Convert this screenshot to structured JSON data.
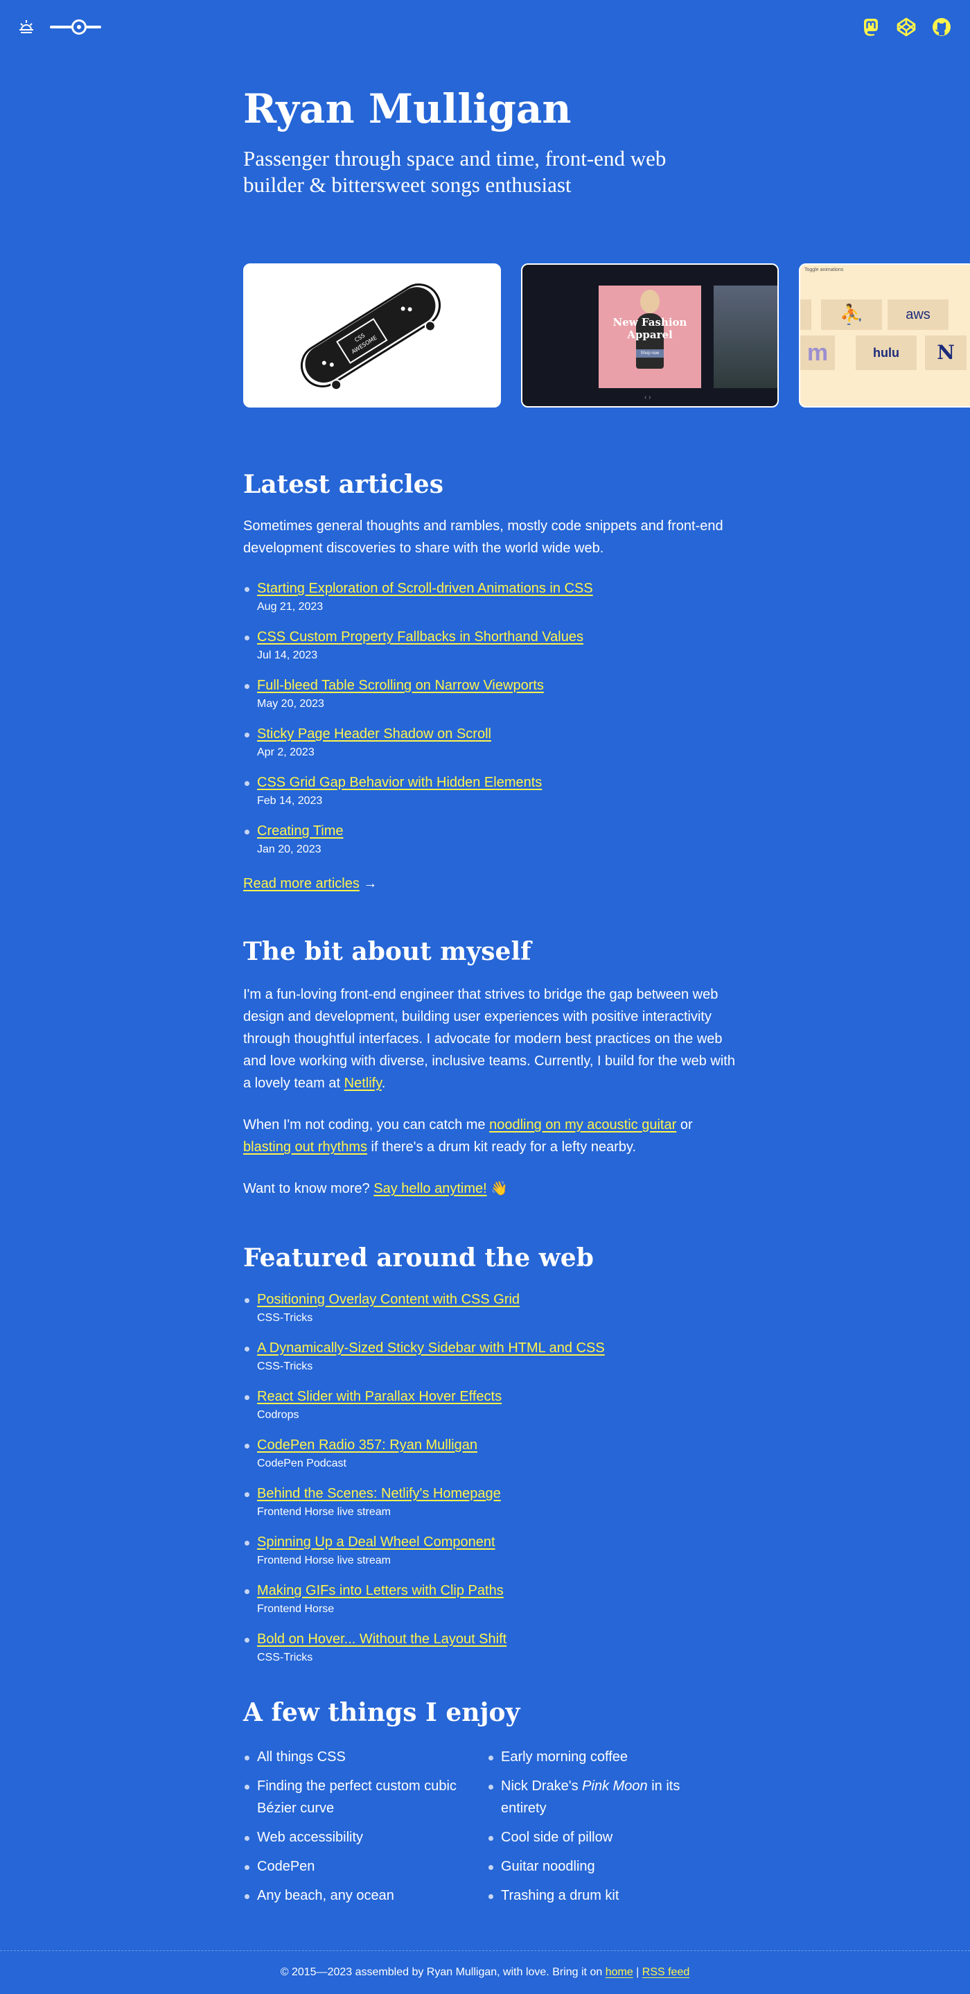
{
  "header": {
    "icons": [
      "sun-icon",
      "mastodon-icon",
      "codepen-icon",
      "github-icon"
    ],
    "slider_level": 0.6
  },
  "hero": {
    "name": "Ryan Mulligan",
    "tagline": "Passenger through space and time, front-end web builder & bittersweet songs enthusiast"
  },
  "cards": {
    "skateboard_text": "CSS\nAWESOME",
    "fashion_title": "New Fashion Apparel",
    "fashion_button": "Shop now",
    "logos_header": "Toggle animations",
    "logos": [
      "aws",
      "hulu",
      "N"
    ]
  },
  "articles": {
    "heading": "Latest articles",
    "intro": "Sometimes general thoughts and rambles, mostly code snippets and front-end development discoveries to share with the world wide web.",
    "items": [
      {
        "title": "Starting Exploration of Scroll-driven Animations in CSS",
        "date": "Aug 21, 2023"
      },
      {
        "title": "CSS Custom Property Fallbacks in Shorthand Values",
        "date": "Jul 14, 2023"
      },
      {
        "title": "Full-bleed Table Scrolling on Narrow Viewports",
        "date": "May 20, 2023"
      },
      {
        "title": "Sticky Page Header Shadow on Scroll",
        "date": "Apr 2, 2023"
      },
      {
        "title": "CSS Grid Gap Behavior with Hidden Elements",
        "date": "Feb 14, 2023"
      },
      {
        "title": "Creating Time",
        "date": "Jan 20, 2023"
      }
    ],
    "read_more": "Read more articles",
    "arrow": "→"
  },
  "about": {
    "heading": "The bit about myself",
    "p1_text": "I'm a fun-loving front-end engineer that strives to bridge the gap between web design and development, building user experiences with positive interactivity through thoughtful interfaces. I advocate for modern best practices on the web and love working with diverse, inclusive teams. Currently, I build for the web with a lovely team at ",
    "p1_link": "Netlify",
    "p1_end": ".",
    "p2_a": "When I'm not coding, you can catch me ",
    "p2_link1": "noodling on my acoustic guitar",
    "p2_b": " or ",
    "p2_link2": "blasting out rhythms",
    "p2_c": " if there's a drum kit ready for a lefty nearby.",
    "p3_a": "Want to know more? ",
    "p3_link": "Say hello anytime!",
    "p3_emoji": "👋"
  },
  "featured": {
    "heading": "Featured around the web",
    "items": [
      {
        "title": "Positioning Overlay Content with CSS Grid",
        "source": "CSS-Tricks"
      },
      {
        "title": "A Dynamically-Sized Sticky Sidebar with HTML and CSS",
        "source": "CSS-Tricks"
      },
      {
        "title": "React Slider with Parallax Hover Effects",
        "source": "Codrops"
      },
      {
        "title": "CodePen Radio 357: Ryan Mulligan",
        "source": "CodePen Podcast"
      },
      {
        "title": "Behind the Scenes: Netlify's Homepage",
        "source": "Frontend Horse live stream"
      },
      {
        "title": "Spinning Up a Deal Wheel Component",
        "source": "Frontend Horse live stream"
      },
      {
        "title": "Making GIFs into Letters with Clip Paths",
        "source": "Frontend Horse"
      },
      {
        "title": "Bold on Hover... Without the Layout Shift",
        "source": "CSS-Tricks"
      }
    ]
  },
  "enjoy": {
    "heading": "A few things I enjoy",
    "left": [
      "All things CSS",
      "Finding the perfect custom cubic Bézier curve",
      "Web accessibility",
      "CodePen",
      "Any beach, any ocean"
    ],
    "right_0": "Early morning coffee",
    "right_1_a": "Nick Drake's ",
    "right_1_em": "Pink Moon",
    "right_1_b": " in its entirety",
    "right_2": "Cool side of pillow",
    "right_3": "Guitar noodling",
    "right_4": "Trashing a drum kit"
  },
  "footer": {
    "text": "© 2015—2023 assembled by Ryan Mulligan, with love. Bring it on ",
    "home": "home",
    "sep": " | ",
    "rss": "RSS feed"
  },
  "colors": {
    "background": "#2666d6",
    "link": "#fff44c",
    "text": "#ffffff"
  }
}
